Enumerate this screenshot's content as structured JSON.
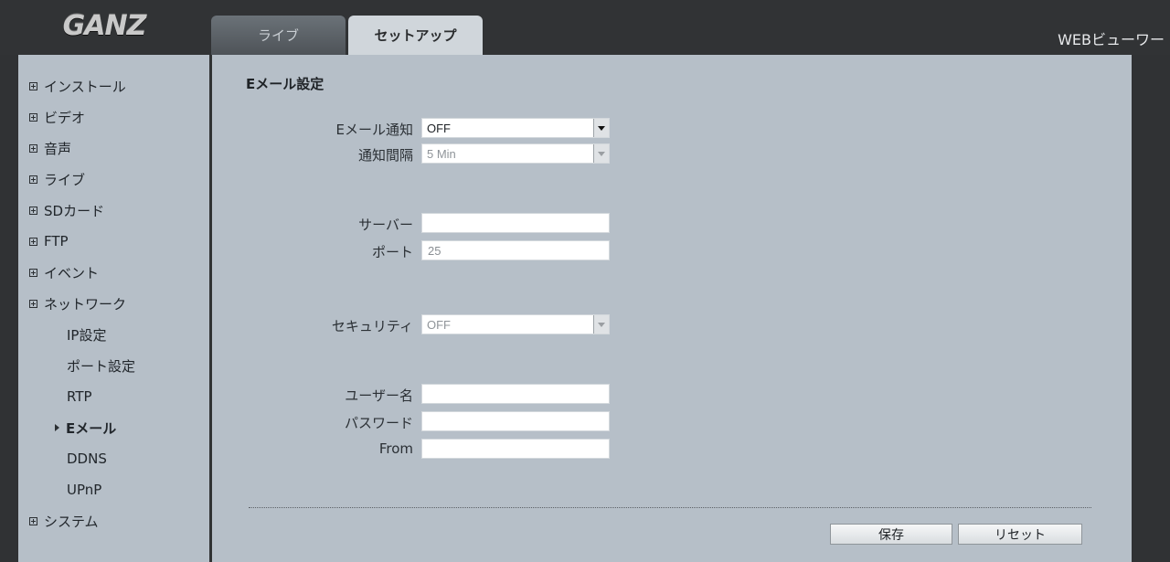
{
  "header": {
    "logo_text": "GANZ",
    "tabs": [
      {
        "label": "ライブ",
        "active": false
      },
      {
        "label": "セットアップ",
        "active": true
      }
    ],
    "viewer_label": "WEBビューワー"
  },
  "sidebar": {
    "items": [
      {
        "label": "インストール"
      },
      {
        "label": "ビデオ"
      },
      {
        "label": "音声"
      },
      {
        "label": "ライブ"
      },
      {
        "label": "SDカード"
      },
      {
        "label": "FTP"
      },
      {
        "label": "イベント"
      },
      {
        "label": "ネットワーク"
      }
    ],
    "network_subitems": [
      {
        "label": "IP設定"
      },
      {
        "label": "ポート設定"
      },
      {
        "label": "RTP"
      },
      {
        "label": "Eメール",
        "active": true
      },
      {
        "label": "DDNS"
      },
      {
        "label": "UPnP"
      }
    ],
    "last_item": {
      "label": "システム"
    }
  },
  "main": {
    "section_title": "Eメール設定",
    "email_notify": {
      "label": "Eメール通知",
      "value": "OFF"
    },
    "notify_interval": {
      "label": "通知間隔",
      "value": "5 Min"
    },
    "server": {
      "label": "サーバー",
      "value": ""
    },
    "port": {
      "label": "ポート",
      "value": "25"
    },
    "security": {
      "label": "セキュリティ",
      "value": "OFF"
    },
    "username": {
      "label": "ユーザー名",
      "value": ""
    },
    "password": {
      "label": "パスワード",
      "value": ""
    },
    "from": {
      "label": "From",
      "value": ""
    },
    "save_label": "保存",
    "reset_label": "リセット"
  },
  "colors": {
    "frame": "#303234",
    "panel": "#b6bfc8",
    "active_tab": "#d0d6db"
  }
}
